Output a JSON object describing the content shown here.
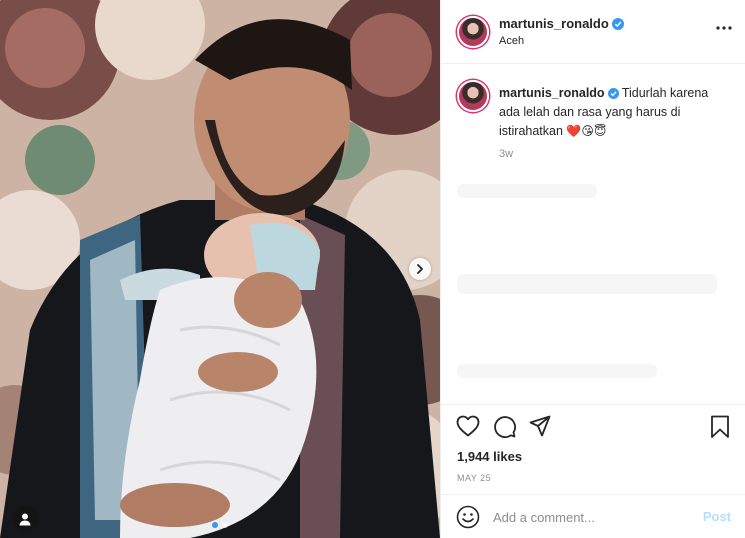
{
  "post": {
    "username": "martunis_ronaldo",
    "location": "Aceh",
    "caption_text": "Tidurlah karena ada lelah dan rasa yang harus di istirahatkan",
    "caption_emojis": "❤️😘😇",
    "caption_age": "3w",
    "likes": "1,944 likes",
    "date": "MAY 25",
    "carousel": {
      "slide_count": 2,
      "active_index": 0
    }
  },
  "comment": {
    "placeholder": "Add a comment...",
    "post_label": "Post"
  },
  "icons": {
    "verified": "verified-badge-icon",
    "more": "more-options-icon",
    "like": "heart-icon",
    "comment": "comment-bubble-icon",
    "share": "paper-plane-icon",
    "save": "bookmark-icon",
    "emoji": "smiley-icon",
    "next": "chevron-right-icon",
    "tag": "user-tag-icon"
  },
  "colors": {
    "verified": "#3897f0",
    "post_button_disabled": "#b2dffc",
    "secondary_text": "#8e8e8e",
    "story_ring": "#e1306c"
  }
}
